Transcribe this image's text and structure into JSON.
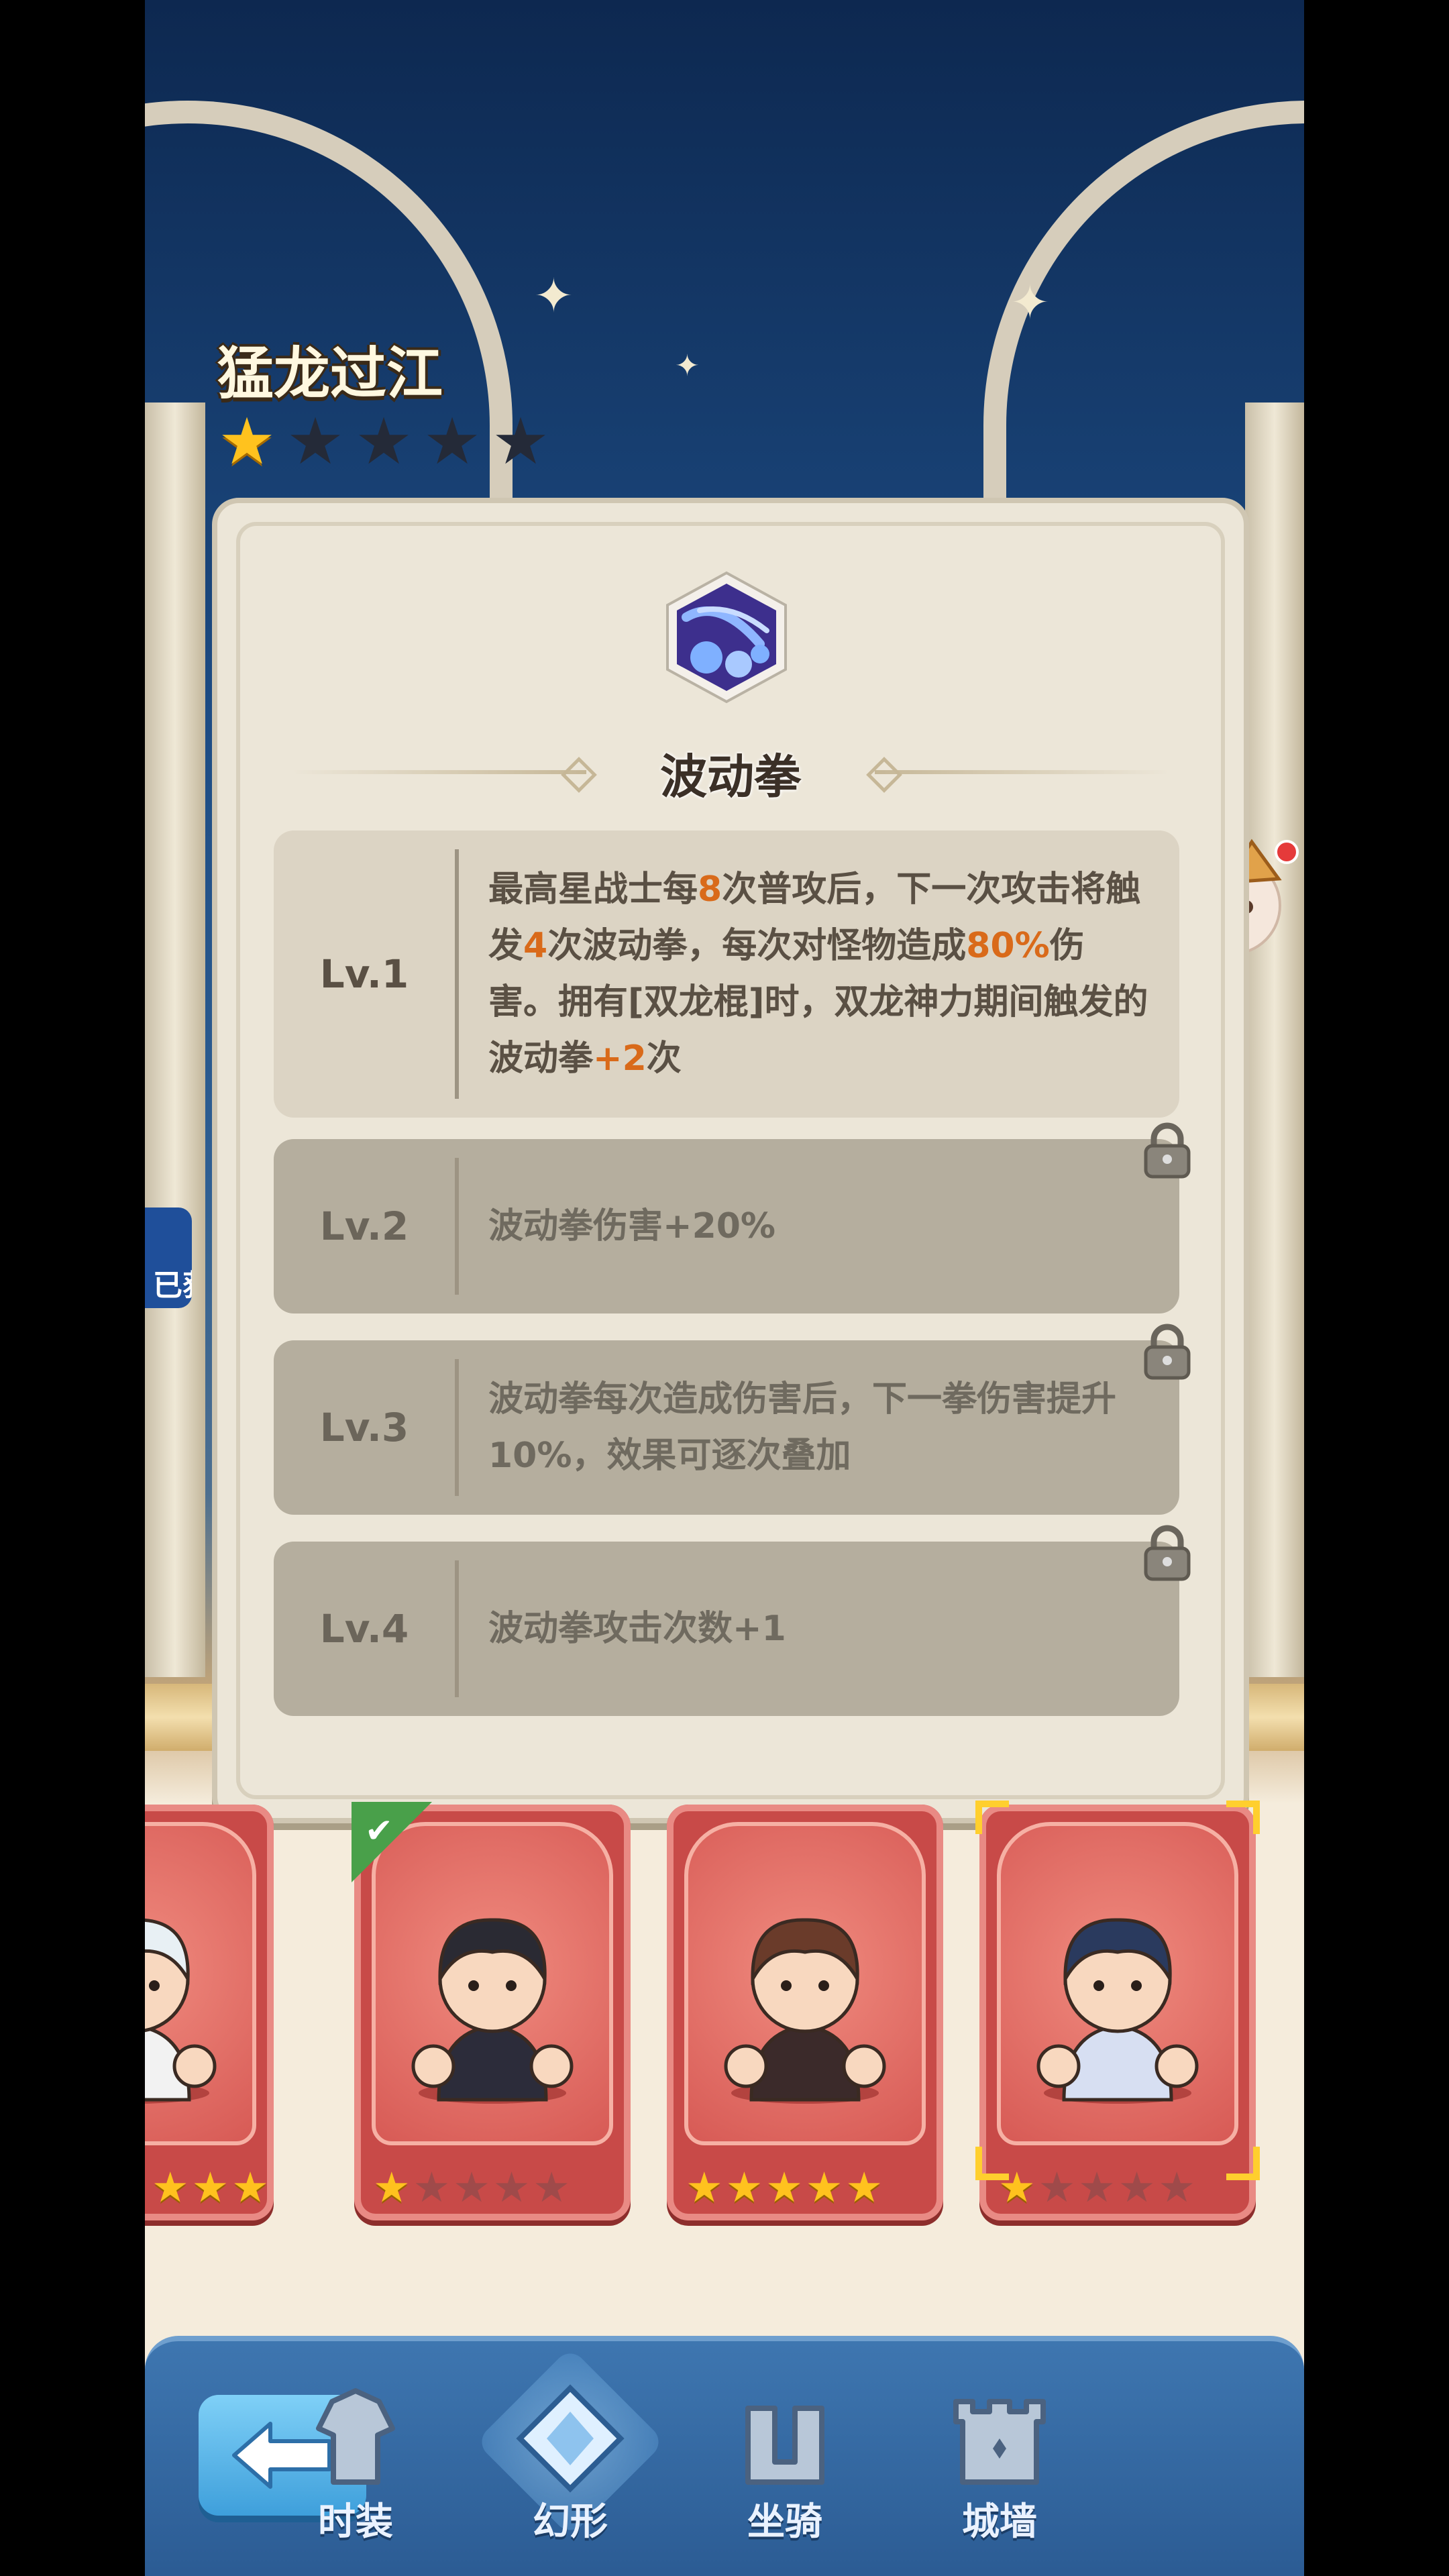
{
  "hero": {
    "title": "猛龙过江",
    "stars_filled": 1,
    "stars_total": 5
  },
  "skill": {
    "name": "波动拳",
    "levels": [
      {
        "label": "Lv.1",
        "locked": false,
        "desc": [
          {
            "t": "最高星战士每"
          },
          {
            "t": "8",
            "hl": true
          },
          {
            "t": "次普攻后，下一次攻击将触发"
          },
          {
            "t": "4",
            "hl": true
          },
          {
            "t": "次波动拳，每次对怪物造成"
          },
          {
            "t": "80%",
            "hl": true
          },
          {
            "t": "伤害。拥有[双龙棍]时，双龙神力期间触发的波动拳"
          },
          {
            "t": "+2",
            "hl": true
          },
          {
            "t": "次"
          }
        ]
      },
      {
        "label": "Lv.2",
        "locked": true,
        "desc": [
          {
            "t": "波动拳伤害+20%"
          }
        ]
      },
      {
        "label": "Lv.3",
        "locked": true,
        "desc": [
          {
            "t": "波动拳每次造成伤害后，下一拳伤害提升10%，效果可逐次叠加"
          }
        ]
      },
      {
        "label": "Lv.4",
        "locked": true,
        "desc": [
          {
            "t": "波动拳攻击次数+1"
          }
        ]
      }
    ]
  },
  "side": {
    "obtained_label": "已获"
  },
  "characters": [
    {
      "stars_filled": 3,
      "stars_total": 3,
      "selected": false,
      "partial": true
    },
    {
      "stars_filled": 1,
      "stars_total": 5,
      "selected": true
    },
    {
      "stars_filled": 5,
      "stars_total": 5,
      "selected": false
    },
    {
      "stars_filled": 1,
      "stars_total": 5,
      "selected": false,
      "current": true
    }
  ],
  "nav": {
    "tabs": [
      {
        "label": "时装",
        "icon": "costume-icon"
      },
      {
        "label": "幻形",
        "icon": "transform-icon",
        "active": true
      },
      {
        "label": "坐骑",
        "icon": "mount-icon"
      },
      {
        "label": "城墙",
        "icon": "castle-wall-icon"
      }
    ]
  },
  "colors": {
    "highlight": "#d96a1a",
    "accent_blue": "#3e9fdb",
    "star": "#ffc21e"
  }
}
